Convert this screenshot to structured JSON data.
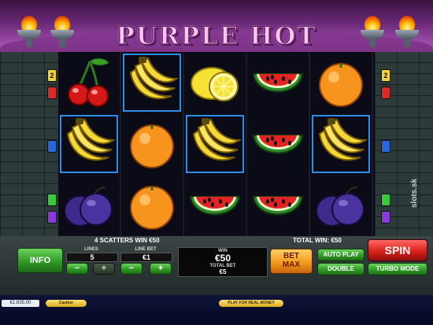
{
  "header": {
    "title": "PURPLE HOT"
  },
  "paylines": {
    "left": [
      "2",
      "",
      "",
      "",
      "",
      ""
    ],
    "right": [
      "2",
      "",
      "",
      "",
      "",
      ""
    ]
  },
  "reels": [
    [
      {
        "symbol": "cherry",
        "highlighted": false
      },
      {
        "symbol": "banana",
        "highlighted": true
      },
      {
        "symbol": "plum",
        "highlighted": false
      }
    ],
    [
      {
        "symbol": "banana",
        "highlighted": true
      },
      {
        "symbol": "orange",
        "highlighted": false
      },
      {
        "symbol": "orange",
        "highlighted": false
      }
    ],
    [
      {
        "symbol": "lemon",
        "highlighted": false
      },
      {
        "symbol": "banana",
        "highlighted": true
      },
      {
        "symbol": "watermelon",
        "highlighted": false
      }
    ],
    [
      {
        "symbol": "watermelon",
        "highlighted": false
      },
      {
        "symbol": "watermelon",
        "highlighted": false
      },
      {
        "symbol": "watermelon",
        "highlighted": false
      }
    ],
    [
      {
        "symbol": "orange",
        "highlighted": false
      },
      {
        "symbol": "banana",
        "highlighted": true
      },
      {
        "symbol": "plum",
        "highlighted": false
      }
    ]
  ],
  "panel": {
    "scatter_message": "4 SCATTERS WIN €50",
    "total_win_message": "TOTAL WIN: €50",
    "info_label": "INFO",
    "lines_label": "LINES",
    "lines_value": "5",
    "line_bet_label": "LINE BET",
    "line_bet_value": "€1",
    "minus": "−",
    "plus": "+",
    "win_label": "WIN",
    "win_value": "€50",
    "total_bet_label": "TOTAL BET",
    "total_bet_value": "€5",
    "bet_max_line1": "BET",
    "bet_max_line2": "MAX",
    "auto_play_label": "AUTO PLAY",
    "double_label": "DOUBLE",
    "spin_label": "SPIN",
    "turbo_label": "TURBO MODE"
  },
  "bottom": {
    "balance": "€1,635.00",
    "cashier": "Cashier",
    "play_real": "PLAY FOR REAL MONEY"
  },
  "watermark": "slots.sk",
  "colors": {
    "highlight": "#2c8ee8",
    "spin_red": "#d9221c",
    "info_green": "#2f9a25",
    "bet_max_orange": "#f39b1d"
  }
}
